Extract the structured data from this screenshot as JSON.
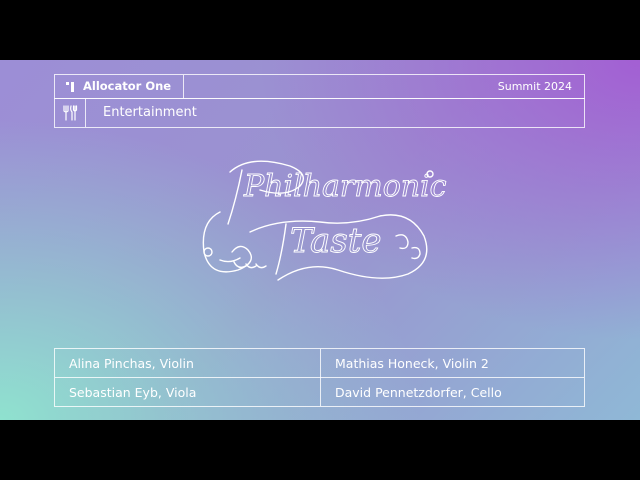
{
  "header": {
    "brand": "Allocator One",
    "event": "Summit 2024",
    "category": "Entertainment",
    "brand_icon": "allocator-logo-icon",
    "category_icon": "utensils-icon"
  },
  "logo": {
    "line1": "Philharmonic",
    "line2": "Taste"
  },
  "roster": [
    [
      "Alina Pinchas, Violin",
      "Mathias Honeck, Violin 2"
    ],
    [
      "Sebastian Eyb, Viola",
      "David Pennetzdorfer, Cello"
    ]
  ],
  "colors": {
    "gradient_mint": "#8fe2cf",
    "gradient_purple": "#a35fd3",
    "gradient_lavender": "#9c8ed6",
    "text": "#ffffff"
  }
}
